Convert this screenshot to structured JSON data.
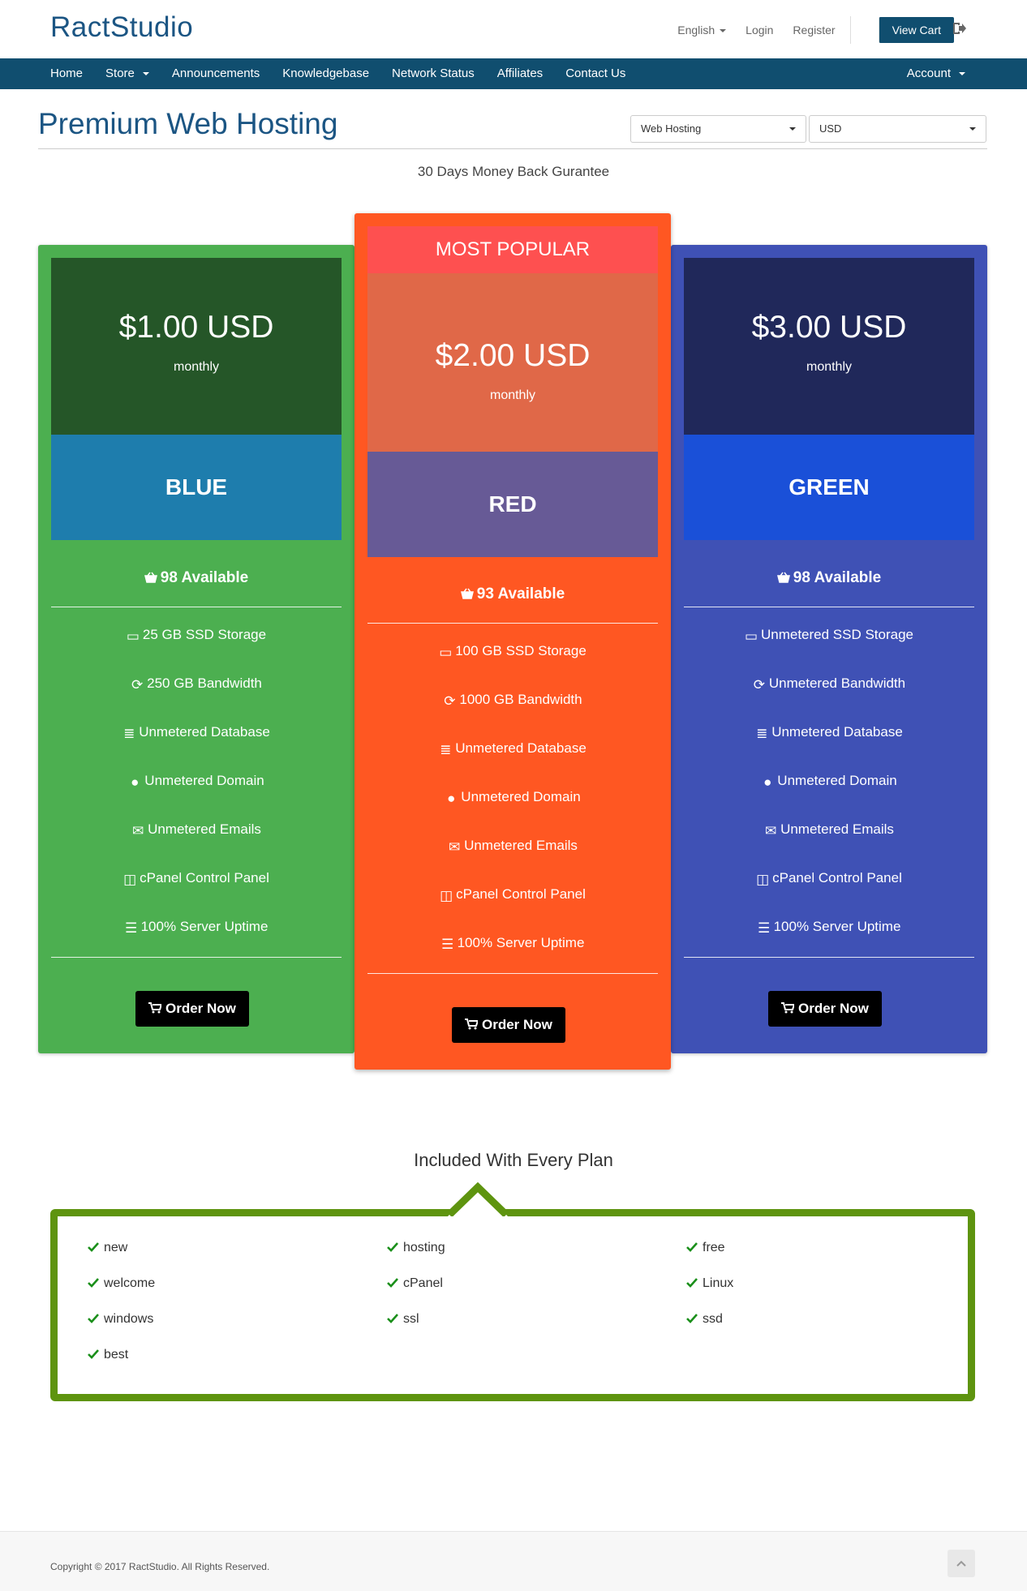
{
  "brand": {
    "name": "RactStudio"
  },
  "toplinks": {
    "language": "English",
    "login": "Login",
    "register": "Register",
    "view_cart": "View Cart"
  },
  "nav": {
    "items": [
      "Home",
      "Store",
      "Announcements",
      "Knowledgebase",
      "Network Status",
      "Affiliates",
      "Contact Us"
    ],
    "account": "Account"
  },
  "page": {
    "title": "Premium Web Hosting",
    "category_select": "Web Hosting",
    "currency_select": "USD",
    "guarantee": "30 Days Money Back Gurantee"
  },
  "plans": [
    {
      "name": "BLUE",
      "price": "$1.00 USD",
      "period": "monthly",
      "available": "98 Available",
      "features": [
        "25 GB SSD Storage",
        "250 GB Bandwidth",
        "Unmetered Database",
        "Unmetered Domain",
        "Unmetered Emails",
        "cPanel Control Panel",
        "100% Server Uptime"
      ],
      "order": "Order Now",
      "colors": {
        "card": "#4caf50",
        "price_bg": "#255628",
        "name_bg": "#1e7dad"
      }
    },
    {
      "badge": "MOST POPULAR",
      "name": "RED",
      "price": "$2.00 USD",
      "period": "monthly",
      "available": "93 Available",
      "features": [
        "100 GB SSD Storage",
        "1000 GB Bandwidth",
        "Unmetered Database",
        "Unmetered Domain",
        "Unmetered Emails",
        "cPanel Control Panel",
        "100% Server Uptime"
      ],
      "order": "Order Now",
      "colors": {
        "card": "#ff5722",
        "badge_bg": "#fe5050",
        "price_bg": "#e06848",
        "name_bg": "#675a96"
      }
    },
    {
      "name": "GREEN",
      "price": "$3.00 USD",
      "period": "monthly",
      "available": "98 Available",
      "features": [
        "Unmetered SSD Storage",
        "Unmetered Bandwidth",
        "Unmetered Database",
        "Unmetered Domain",
        "Unmetered Emails",
        "cPanel Control Panel",
        "100% Server Uptime"
      ],
      "order": "Order Now",
      "colors": {
        "card": "#3f51b5",
        "price_bg": "#20285a",
        "name_bg": "#1a50d8"
      }
    }
  ],
  "included": {
    "title": "Included With Every Plan",
    "items": [
      "new",
      "hosting",
      "free",
      "welcome",
      "cPanel",
      "Linux",
      "windows",
      "ssl",
      "ssd",
      "best"
    ],
    "accent": "#5e940f"
  },
  "footer": {
    "copyright": "Copyright © 2017 RactStudio. All Rights Reserved."
  }
}
